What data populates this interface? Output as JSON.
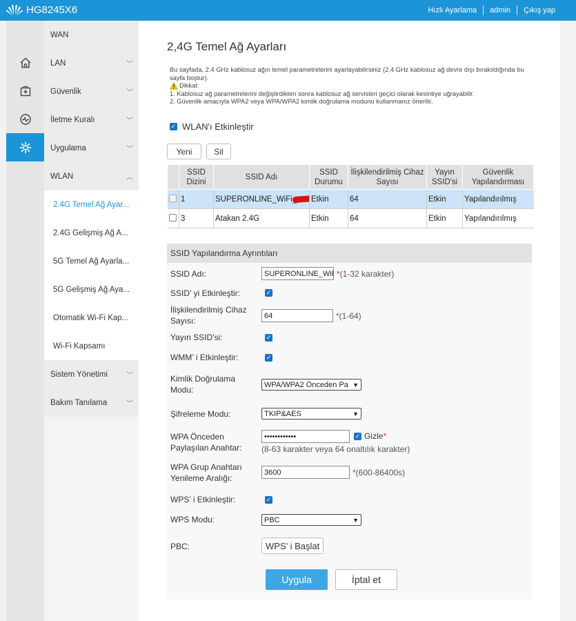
{
  "header": {
    "product": "HG8245X6",
    "links": [
      "Hızlı Ayarlama",
      "admin",
      "Çıkış yap"
    ]
  },
  "rail_icons": [
    "home-icon",
    "first-aid-icon",
    "activity-icon",
    "gear-icon"
  ],
  "sidebar": {
    "items": [
      {
        "label": "WAN",
        "chevron": ""
      },
      {
        "label": "LAN",
        "chevron": "﹀"
      },
      {
        "label": "Güvenlik",
        "chevron": "﹀"
      },
      {
        "label": "İletme Kuralı",
        "chevron": "﹀"
      },
      {
        "label": "Uygulama",
        "chevron": "﹀"
      },
      {
        "label": "WLAN",
        "chevron": "︿"
      }
    ],
    "sub_items": [
      "2.4G Temel Ağ Ayar...",
      "2.4G Gelişmiş Ağ A...",
      "5G Temel Ağ Ayarla...",
      "5G Gelişmiş Ağ Aya...",
      "Otomatik Wi-Fi Kap...",
      "Wi-Fi Kapsamı"
    ],
    "bottom_items": [
      {
        "label": "Sistem Yönetimi",
        "chevron": "﹀"
      },
      {
        "label": "Bakım Tanılama",
        "chevron": "﹀"
      }
    ]
  },
  "page": {
    "title": "2,4G Temel Ağ Ayarları",
    "description": "Bu sayfada, 2.4 GHz kablosuz ağın temel parametrelerini ayarlayabilirsiniz (2.4 GHz kablosuz ağ devre dışı bırakıldığında bu sayfa boştur).",
    "warning_title": "Dikkat:",
    "notes": [
      "1. Kablosuz ağ parametrelerini değiştirdikten sonra kablosuz ağ servisleri geçici olarak kesintiye uğrayabilir.",
      "2. Güvenlik amacıyla WPA2 veya WPA/WPA2 kimlik doğrulama modunu kullanmanız önerilir."
    ],
    "enable_wlan_label": "WLAN'ı Etkinleştir",
    "new_button": "Yeni",
    "delete_button": "Sil"
  },
  "ssid_table": {
    "headers": [
      "",
      "SSID Dizini",
      "SSID Adı",
      "SSID Durumu",
      "İlişkilendirilmiş Cihaz Sayısı",
      "Yayın SSID'si",
      "Güvenlik Yapılandırması"
    ],
    "rows": [
      {
        "index": "1",
        "name": "SUPERONLINE_WiFi_",
        "status": "Etkin",
        "devices": "64",
        "broadcast": "Etkin",
        "security": "Yapılandırılmış"
      },
      {
        "index": "3",
        "name": "Atakan 2.4G",
        "status": "Etkin",
        "devices": "64",
        "broadcast": "Etkin",
        "security": "Yapılandırılmış"
      }
    ]
  },
  "config": {
    "heading": "SSID Yapılandırma Ayrıntıları",
    "ssid_name_label": "SSID Adı:",
    "ssid_name_value": "SUPERONLINE_WiF",
    "ssid_name_hint": "(1-32 karakter)",
    "ssid_enable_label": "SSID’ yi Etkinleştir:",
    "assoc_label": "İlişkilendirilmiş Cihaz Sayısı:",
    "assoc_value": "64",
    "assoc_hint": "(1-64)",
    "broadcast_label": "Yayın SSID’si:",
    "wmm_label": "WMM’ i Etkinleştir:",
    "auth_label": "Kimlik Doğrulama Modu:",
    "auth_value": "WPA/WPA2 Önceden Pa",
    "enc_label": "Şifreleme Modu:",
    "enc_value": "TKIP&AES",
    "psk_label": "WPA Önceden Paylaşılan Anahtar:",
    "psk_value": "••••••••••••",
    "hide_label": "Gizle",
    "psk_hint": "(8-63 karakter veya 64 onaltılık karakter)",
    "rekey_label": "WPA Grup Anahtarı Yenileme Aralığı:",
    "rekey_value": "3600",
    "rekey_hint": "(600-86400s)",
    "wps_enable_label": "WPS’ i Etkinleştir:",
    "wps_mode_label": "WPS Modu:",
    "wps_mode_value": "PBC",
    "pbc_label": "PBC:",
    "wps_start_button": "WPS’ i Başlat",
    "apply_button": "Uygula",
    "cancel_button": "İptal et"
  },
  "colors": {
    "brand": "#1c94d8",
    "apply": "#3da7e6",
    "selected_row": "#cde3f7",
    "required": "#e03030"
  }
}
